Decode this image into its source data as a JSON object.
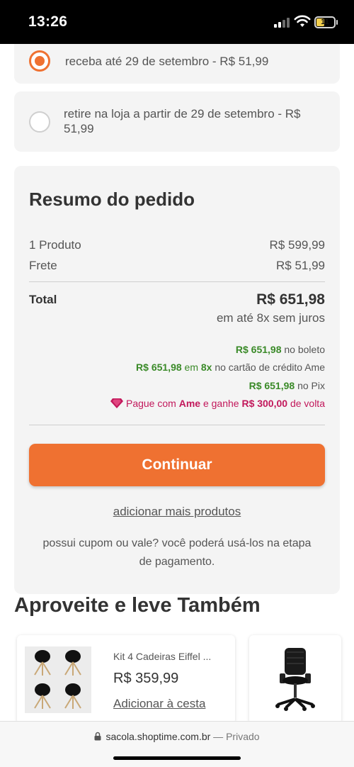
{
  "status_bar": {
    "time": "13:26",
    "battery": "11"
  },
  "shipping": {
    "option1": "receba até 29 de setembro - R$ 51,99",
    "option2": "retire na loja a partir de 29 de setembro - R$ 51,99"
  },
  "summary": {
    "title": "Resumo do pedido",
    "products_label": "1 Produto",
    "products_value": "R$ 599,99",
    "shipping_label": "Frete",
    "shipping_value": "R$ 51,99",
    "total_label": "Total",
    "total_value": "R$ 651,98",
    "installments": "em até 8x sem juros",
    "boleto_amount": "R$ 651,98",
    "boleto_text": " no boleto",
    "card_amount": "R$ 651,98",
    "card_em": " em ",
    "card_times": "8x",
    "card_text": " no cartão de crédito Ame",
    "pix_amount": "R$ 651,98",
    "pix_text": " no Pix",
    "ame_pre": "Pague com ",
    "ame_brand": "Ame",
    "ame_mid": " e ganhe ",
    "ame_amount": "R$ 300,00",
    "ame_post": " de volta",
    "continue_button": "Continuar",
    "add_more_link": "adicionar mais produtos",
    "coupon_text": "possui cupom ou vale? você poderá usá-los na etapa de pagamento."
  },
  "recommendations": {
    "title": "Aproveite e leve Também",
    "products": [
      {
        "name": "Kit 4 Cadeiras Eiffel ...",
        "price": "R$ 359,99",
        "add_label": "Adicionar à cesta"
      }
    ]
  },
  "browser": {
    "domain": "sacola.shoptime.com.br",
    "separator": " — ",
    "private_label": "Privado"
  },
  "colors": {
    "accent": "#ef7131",
    "green": "#3a8a28",
    "ame_pink": "#c2185b"
  }
}
